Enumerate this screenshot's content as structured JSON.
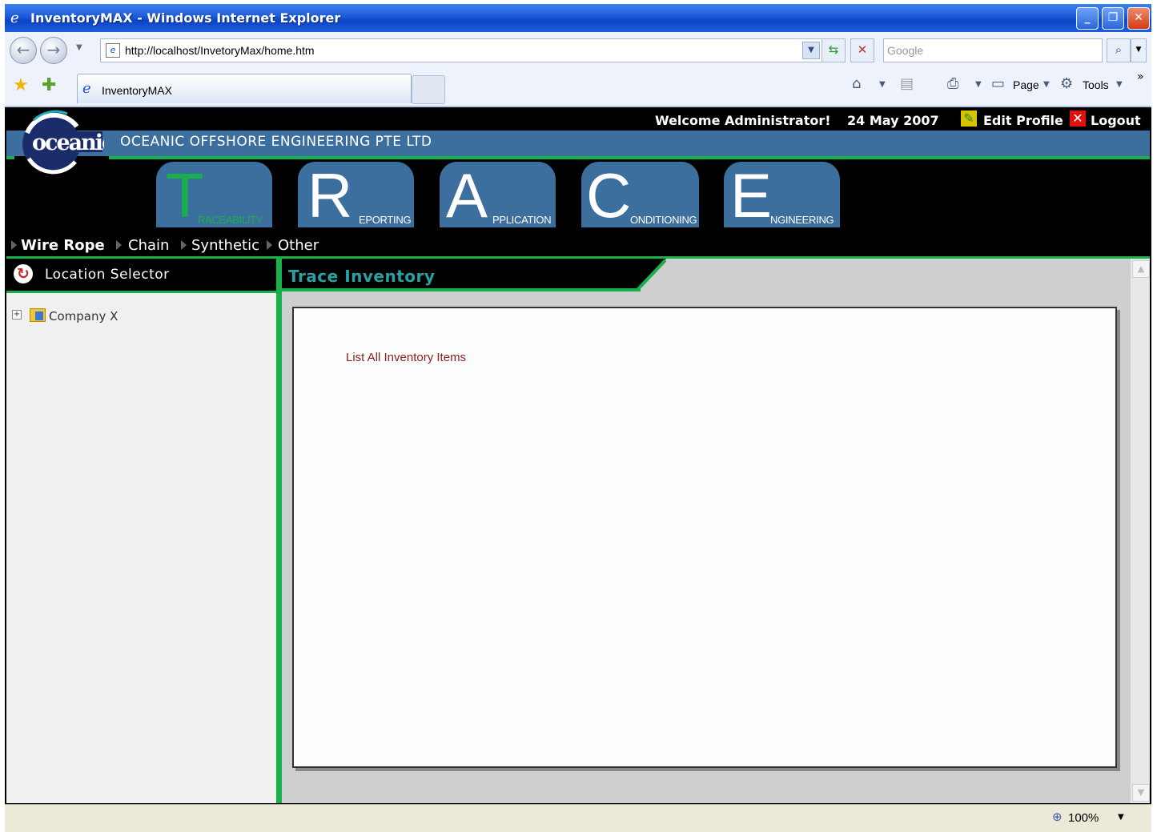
{
  "window": {
    "title": "InventoryMAX - Windows Internet Explorer"
  },
  "browser": {
    "url": "http://localhost/InvetoryMax/home.htm",
    "search_placeholder": "Google",
    "tab_label": "InventoryMAX",
    "commands": {
      "page": "Page",
      "tools": "Tools"
    },
    "zoom": "100%"
  },
  "header": {
    "logo_text": "oceanic",
    "company": "OCEANIC OFFSHORE ENGINEERING PTE LTD",
    "welcome": "Welcome Administrator!",
    "date": "24 May 2007",
    "edit_profile": "Edit Profile",
    "logout": "Logout"
  },
  "trace": [
    {
      "letter": "T",
      "word": "RACEABILITY"
    },
    {
      "letter": "R",
      "word": "EPORTING"
    },
    {
      "letter": "A",
      "word": "PPLICATION"
    },
    {
      "letter": "C",
      "word": "ONDITIONING"
    },
    {
      "letter": "E",
      "word": "NGINEERING"
    }
  ],
  "nav": [
    "Wire Rope",
    "Chain",
    "Synthetic",
    "Other"
  ],
  "left_panel": {
    "title": "Location Selector",
    "tree_root": "Company X"
  },
  "right_panel": {
    "title": "Trace Inventory",
    "link": "List All Inventory Items"
  },
  "colors": {
    "accent_green": "#18b04a",
    "header_blue": "#3c6f9e",
    "title_teal": "#2aa0a0",
    "link_red": "#8b1e1e"
  }
}
